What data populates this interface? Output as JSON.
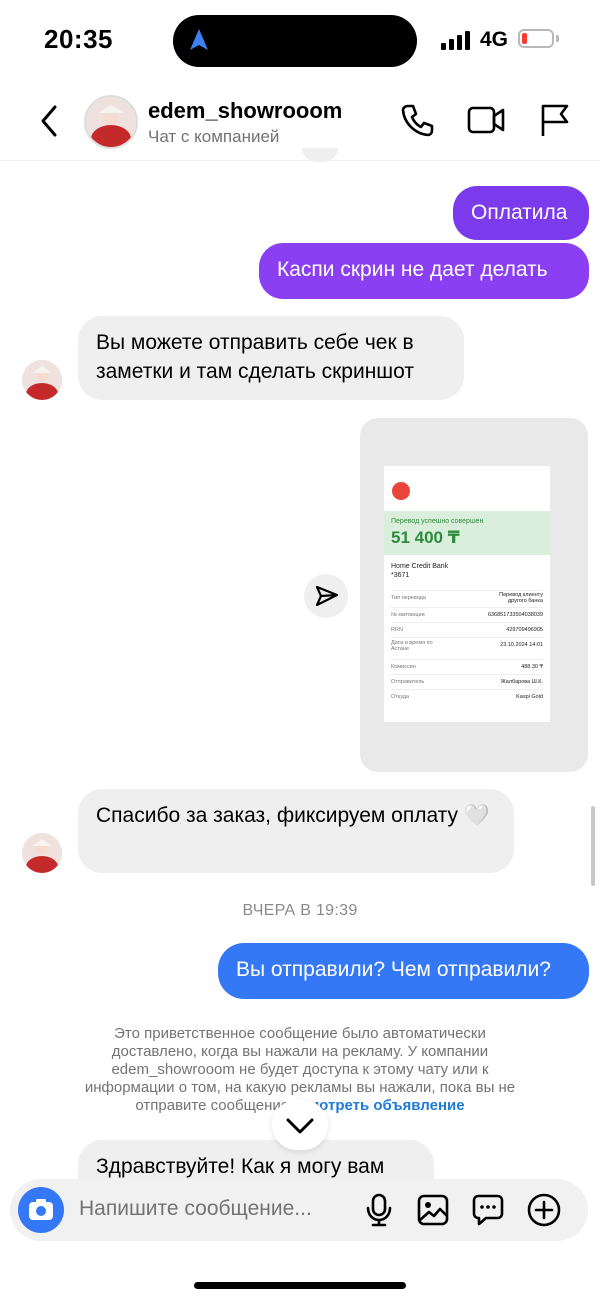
{
  "status_bar": {
    "time": "20:35",
    "network": "4G"
  },
  "header": {
    "name": "edem_showrooom",
    "subtitle": "Чат с компанией"
  },
  "messages": {
    "out_1": "Оплатила",
    "out_2": "Каспи скрин не дает делать",
    "in_1": "Вы можете отправить себе чек в заметки и там сделать скриншот",
    "in_2": "Спасибо за заказ, фиксируем оплату 🤍",
    "date_separator": "ВЧЕРА В 19:39",
    "out_3": "Вы отправили? Чем отправили?",
    "in_3": "Здравствуйте! Как я могу вам"
  },
  "receipt": {
    "success": "Перевод успешно совершен",
    "amount": "51 400 ₸",
    "bank": "Home Credit Bank",
    "account": "*3671",
    "rows": [
      {
        "k": "Тип перевода",
        "v": "Перевод клиенту другого банка"
      },
      {
        "k": "№ квитанции",
        "v": "636851733504038039"
      },
      {
        "k": "RRN",
        "v": "429709496905"
      },
      {
        "k": "Дата и время по Астане",
        "v": "23.10.2024 14:01"
      },
      {
        "k": "Комиссия",
        "v": "488.30 ₸"
      },
      {
        "k": "Отправитель",
        "v": "Жалбарова Ш.К."
      },
      {
        "k": "Откуда",
        "v": "Kaspi Gold"
      }
    ]
  },
  "notice": {
    "text": "Это приветственное сообщение было автоматически доставлено, когда вы нажали на рекламу. У компании edem_showrooom не будет доступа к этому чату или к информации о том, на какую рекламы вы нажали, пока вы не отправите сообщение.",
    "link": "Смотреть объявление"
  },
  "composer": {
    "placeholder": "Напишите сообщение..."
  },
  "colors": {
    "outgoing": "#7c3aed",
    "outgoing_blue": "#3478f6",
    "incoming": "#efefef",
    "link": "#1d7bd7"
  },
  "icons": [
    "location-arrow-icon",
    "signal-icon",
    "battery-icon",
    "back-chevron-icon",
    "phone-icon",
    "video-icon",
    "flag-icon",
    "share-icon",
    "chevron-down-icon",
    "camera-icon",
    "microphone-icon",
    "gallery-icon",
    "sticker-icon",
    "plus-icon"
  ]
}
